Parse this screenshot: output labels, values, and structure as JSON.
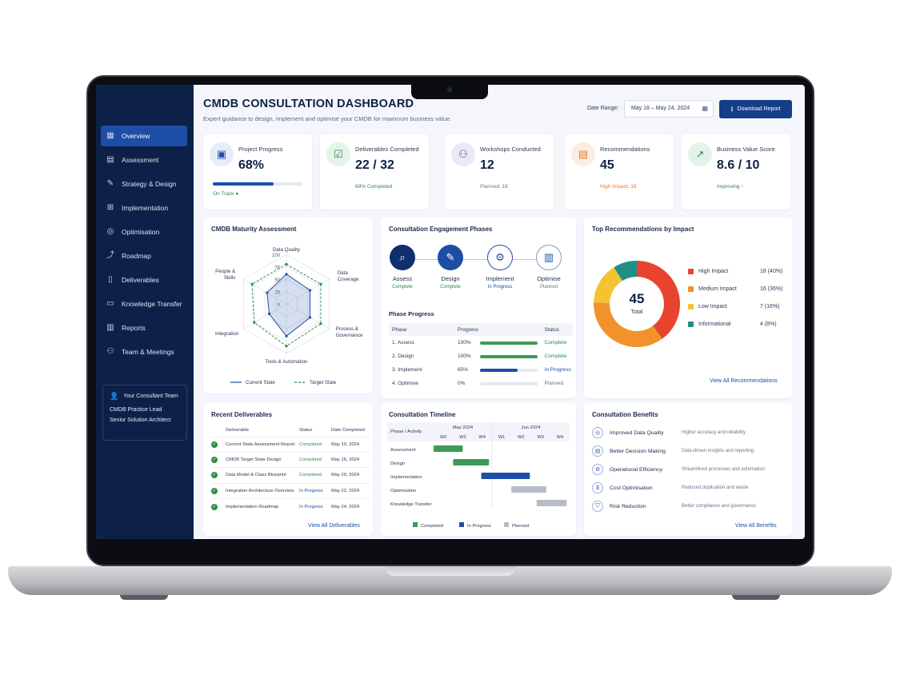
{
  "header": {
    "title": "CMDB CONSULTATION DASHBOARD",
    "subtitle": "Expert guidance to design, implement and optimise your CMDB for maximum business value.",
    "date_label": "Date Range:",
    "date_value": "May 18 – May 24, 2024",
    "download_label": "Download Report"
  },
  "sidebar": {
    "items": [
      {
        "label": "Overview",
        "icon": "grid-icon"
      },
      {
        "label": "Assessment",
        "icon": "clipboard-icon"
      },
      {
        "label": "Strategy & Design",
        "icon": "pencil-icon"
      },
      {
        "label": "Implementation",
        "icon": "puzzle-icon"
      },
      {
        "label": "Optimisation",
        "icon": "gauge-icon"
      },
      {
        "label": "Roadmap",
        "icon": "chart-icon"
      },
      {
        "label": "Deliverables",
        "icon": "document-icon"
      },
      {
        "label": "Knowledge Transfer",
        "icon": "book-icon"
      },
      {
        "label": "Reports",
        "icon": "report-icon"
      },
      {
        "label": "Team & Meetings",
        "icon": "people-icon"
      }
    ],
    "team": {
      "title": "Your Consultant Team",
      "line1": "CMDB Practice Lead",
      "line2": "Senior Solution Architect"
    }
  },
  "kpis": [
    {
      "label": "Project Progress",
      "value": "68%",
      "sub": "On Track",
      "progress": 0.68,
      "color": "#2e8b4a"
    },
    {
      "label": "Deliverables Completed",
      "value": "22 / 32",
      "sub": "69% Completed",
      "color": "#2e8b4a"
    },
    {
      "label": "Workshops Conducted",
      "value": "12",
      "sub": "Planned: 18",
      "color": "#6b7590"
    },
    {
      "label": "Recommendations",
      "value": "45",
      "sub": "High Impact: 18",
      "color": "#e8772e"
    },
    {
      "label": "Business Value Score",
      "value": "8.6 / 10",
      "sub": "Improving",
      "color": "#2e8b4a"
    }
  ],
  "maturity": {
    "title": "CMDB Maturity Assessment",
    "axes": [
      "Data Quality",
      "Data Coverage",
      "Process & Governance",
      "Tools & Automation",
      "Integration",
      "People & Skills"
    ],
    "axis_label_lines": [
      [
        "Data Quality"
      ],
      [
        "Data",
        "Coverage"
      ],
      [
        "Process &",
        "Governance"
      ],
      [
        "Tools & Automation"
      ],
      [
        "Integration"
      ],
      [
        "People &",
        "Skills"
      ]
    ],
    "ticks": [
      "100",
      "75",
      "50",
      "25",
      "0"
    ],
    "current": [
      60,
      55,
      55,
      65,
      40,
      45
    ],
    "target": [
      80,
      80,
      80,
      85,
      75,
      80
    ],
    "legend_current": "Current State",
    "legend_target": "Target State"
  },
  "phases": {
    "title": "Consultation Engagement Phases",
    "items": [
      {
        "name": "Assess",
        "status": "Complete",
        "icon": "search-icon"
      },
      {
        "name": "Design",
        "status": "Complete",
        "icon": "edit-icon"
      },
      {
        "name": "Implement",
        "status": "In Progress",
        "icon": "cog-icon"
      },
      {
        "name": "Optimise",
        "status": "Planned",
        "icon": "bars-icon"
      }
    ],
    "progress_title": "Phase Progress",
    "columns": [
      "Phase",
      "Progress",
      "Status"
    ],
    "rows": [
      {
        "phase": "1. Assess",
        "pct": "100%",
        "value": 1.0,
        "status": "Complete"
      },
      {
        "phase": "2. Design",
        "pct": "100%",
        "value": 1.0,
        "status": "Complete"
      },
      {
        "phase": "3. Implement",
        "pct": "65%",
        "value": 0.65,
        "status": "In Progress"
      },
      {
        "phase": "4. Optimise",
        "pct": "0%",
        "value": 0.0,
        "status": "Planned"
      }
    ]
  },
  "recommendations": {
    "title": "Top Recommendations by Impact",
    "total": "45",
    "total_label": "Total",
    "items": [
      {
        "label": "High Impact",
        "value": "18 (40%)",
        "count": 18,
        "color": "#e8432e"
      },
      {
        "label": "Medium Impact",
        "value": "16 (36%)",
        "count": 16,
        "color": "#f2922b"
      },
      {
        "label": "Low Impact",
        "value": "7 (16%)",
        "count": 7,
        "color": "#f5c232"
      },
      {
        "label": "Informational",
        "value": "4 (8%)",
        "count": 4,
        "color": "#1f8f86"
      }
    ],
    "link": "View All Recommendations"
  },
  "deliverables": {
    "title": "Recent Deliverables",
    "columns": [
      "Deliverable",
      "Status",
      "Date Completed"
    ],
    "rows": [
      {
        "name": "Current State Assessment Report",
        "status": "Completed",
        "date": "May 10, 2024"
      },
      {
        "name": "CMDB Target State Design",
        "status": "Completed",
        "date": "May 16, 2024"
      },
      {
        "name": "Data Model & Class Blueprint",
        "status": "Completed",
        "date": "May 20, 2024"
      },
      {
        "name": "Integration Architecture Overview",
        "status": "In Progress",
        "date": "May 22, 2024"
      },
      {
        "name": "Implementation Roadmap",
        "status": "In Progress",
        "date": "May 24, 2024"
      }
    ],
    "link": "View All Deliverables"
  },
  "timeline": {
    "title": "Consultation Timeline",
    "col_header": "Phase / Activity",
    "months": [
      "May 2024",
      "Jun 2024"
    ],
    "weeks": [
      "W2",
      "W3",
      "W4",
      "W1",
      "W2",
      "W3",
      "W4"
    ],
    "rows": [
      {
        "name": "Assessment",
        "start": 0,
        "end": 1.5,
        "status": "completed"
      },
      {
        "name": "Design",
        "start": 1.0,
        "end": 2.85,
        "status": "completed"
      },
      {
        "name": "Implementation",
        "start": 2.45,
        "end": 4.95,
        "status": "inprogress"
      },
      {
        "name": "Optimisation",
        "start": 4.0,
        "end": 5.8,
        "status": "planned"
      },
      {
        "name": "Knowledge Transfer",
        "start": 5.3,
        "end": 6.85,
        "status": "planned"
      }
    ],
    "legend": [
      "Completed",
      "In Progress",
      "Planned"
    ],
    "colors": {
      "completed": "#3d9a57",
      "inprogress": "#1d4ea5",
      "planned": "#b7bcc8"
    }
  },
  "benefits": {
    "title": "Consultation Benefits",
    "rows": [
      {
        "name": "Improved Data Quality",
        "desc": "Higher accuracy and reliability"
      },
      {
        "name": "Better Decision Making",
        "desc": "Data-driven insights and reporting"
      },
      {
        "name": "Operational Efficiency",
        "desc": "Streamlined processes and automation"
      },
      {
        "name": "Cost Optimisation",
        "desc": "Reduced duplication and waste"
      },
      {
        "name": "Risk Reduction",
        "desc": "Better compliance and governance"
      }
    ],
    "link": "View All Benefits"
  },
  "colors": {
    "navy": "#0d2148",
    "accent": "#1d4ea5",
    "complete": "#2e8b4a",
    "warning": "#e8772e"
  }
}
